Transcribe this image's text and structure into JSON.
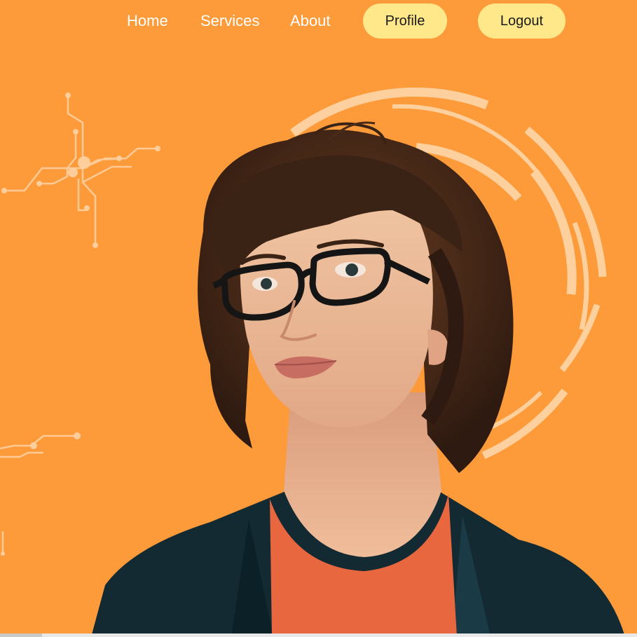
{
  "nav": {
    "links": [
      {
        "label": "Home"
      },
      {
        "label": "Services"
      },
      {
        "label": "About"
      }
    ],
    "profile_label": "Profile",
    "logout_label": "Logout"
  },
  "colors": {
    "background": "#fd9a39",
    "button_bg": "#ffe88a",
    "nav_text": "#ffffff",
    "decor_line": "#ffd6a8"
  },
  "hero": {
    "image": "portrait of a young person with glasses looking up"
  }
}
